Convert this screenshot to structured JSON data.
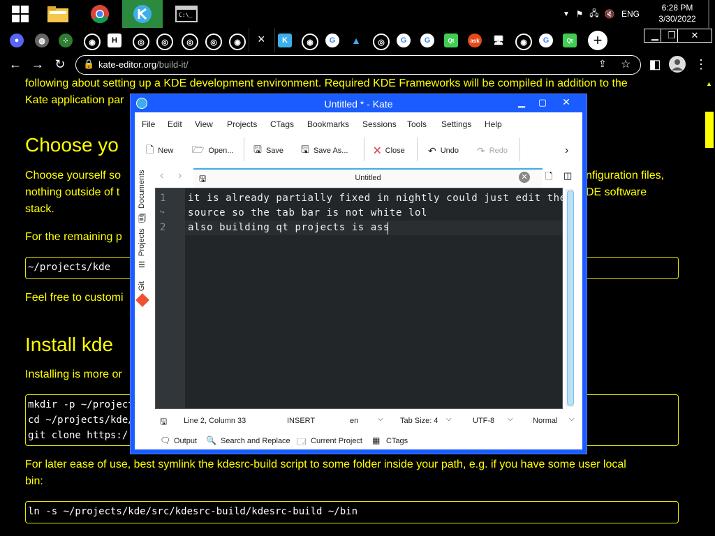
{
  "taskbar": {
    "time": "6:28 PM",
    "date": "3/30/2022",
    "lang": "ENG"
  },
  "browser": {
    "url_domain": "kate-editor.org",
    "url_path": "/build-it/",
    "tab_close": "×"
  },
  "page": {
    "line1": "following about setting up a KDE development environment. Required KDE Frameworks will be compiled in addition to the",
    "line2": "Kate application par",
    "heading_choose": "Choose yo",
    "choose_line1_a": "Choose yourself so",
    "choose_line1_b": "nfiguration files,",
    "choose_line2_a": "nothing outside of t",
    "choose_line2_b": "DE software",
    "choose_line3": "stack.",
    "remaining": "For the remaining p",
    "code_path": "~/projects/kde",
    "feel_free": "Feel free to customi",
    "heading_install": "Install kde",
    "installing": "Installing is more or",
    "code_block": [
      "mkdir -p ~/project",
      "cd ~/projects/kde/",
      "git clone https:/"
    ],
    "later_line1": "For later ease of use, best symlink the kdesrc-build script to some folder inside your path, e.g. if you have some user local",
    "later_line2": "bin:",
    "code_ln": "ln -s ~/projects/kde/src/kdesrc-build/kdesrc-build ~/bin"
  },
  "kate": {
    "title": "Untitled * - Kate",
    "menu": [
      "File",
      "Edit",
      "View",
      "Projects",
      "CTags",
      "Bookmarks",
      "Sessions",
      "Tools",
      "Settings",
      "Help"
    ],
    "toolbar": {
      "new": "New",
      "open": "Open...",
      "save": "Save",
      "save_as": "Save As...",
      "close": "Close",
      "undo": "Undo",
      "redo": "Redo"
    },
    "side": {
      "documents": "Documents",
      "projects": "Projects",
      "git": "Git"
    },
    "doc_tab": "Untitled",
    "lines": [
      {
        "no": "1",
        "text": "it is already partially fixed in nightly could just edit the"
      },
      {
        "no": "",
        "text": "source so the tab bar is not white lol"
      },
      {
        "no": "2",
        "text": "also building qt projects is ass"
      }
    ],
    "status": {
      "position": "Line 2, Column 33",
      "mode": "INSERT",
      "lang": "en",
      "tab_size": "Tab Size: 4",
      "encoding": "UTF-8",
      "syntax": "Normal"
    },
    "bottom": {
      "output": "Output",
      "search": "Search and Replace",
      "project": "Current Project",
      "ctags": "CTags"
    }
  }
}
